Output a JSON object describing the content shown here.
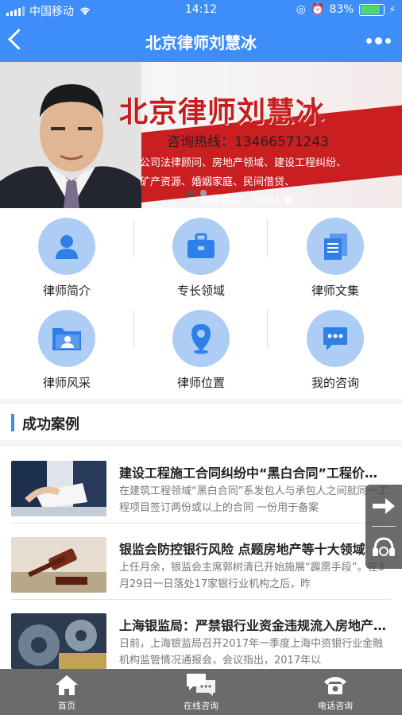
{
  "status": {
    "carrier": "中国移动",
    "time": "14:12",
    "battery": "83%"
  },
  "nav": {
    "title": "北京律师刘慧冰",
    "back_icon": "back-arrow-icon",
    "more_icon": "more-dots-icon"
  },
  "banner": {
    "headline": "北京律师刘慧冰",
    "hotline": "咨询热线：13466571243",
    "lines": [
      "公司法律顾问、房地产领域、建设工程纠纷、",
      "矿产资源、婚姻家庭、民间借贷、",
      "物业管理、劳动人事"
    ],
    "slide_count": 2,
    "active_slide": 1
  },
  "grid": [
    {
      "label": "律师简介",
      "icon": "person-icon"
    },
    {
      "label": "专长领域",
      "icon": "briefcase-icon"
    },
    {
      "label": "律师文集",
      "icon": "documents-icon"
    },
    {
      "label": "律师风采",
      "icon": "folder-person-icon"
    },
    {
      "label": "律师位置",
      "icon": "location-pin-icon"
    },
    {
      "label": "我的咨询",
      "icon": "chat-bubble-icon"
    }
  ],
  "section": {
    "title": "成功案例"
  },
  "cases": [
    {
      "title": "建设工程施工合同纠纷中“黑白合同”工程价款的结算",
      "desc": "在建筑工程领域“黑白合同”系发包人与承包人之间就同一工程项目签订两份或以上的合同 一份用于备案"
    },
    {
      "title": "银监会防控银行风险 点题房地产等十大领域",
      "desc": "上任月余，银监会主席郭树清已开始施展“霹雳手段”。在3月29日一日落处17家银行业机构之后，昨"
    },
    {
      "title": "上海银监局：严禁银行业资金违规流入房地产市场",
      "desc": "日前，上海银监局召开2017年一季度上海中资银行业金融机构监管情况通报会，会议指出，2017年以"
    }
  ],
  "float_actions": {
    "share_icon": "share-arrow-icon",
    "service_icon": "headset-icon"
  },
  "tabbar": [
    {
      "label": "首页",
      "icon": "home-icon"
    },
    {
      "label": "在线咨询",
      "icon": "chat-icon"
    },
    {
      "label": "电话咨询",
      "icon": "phone-icon"
    }
  ]
}
